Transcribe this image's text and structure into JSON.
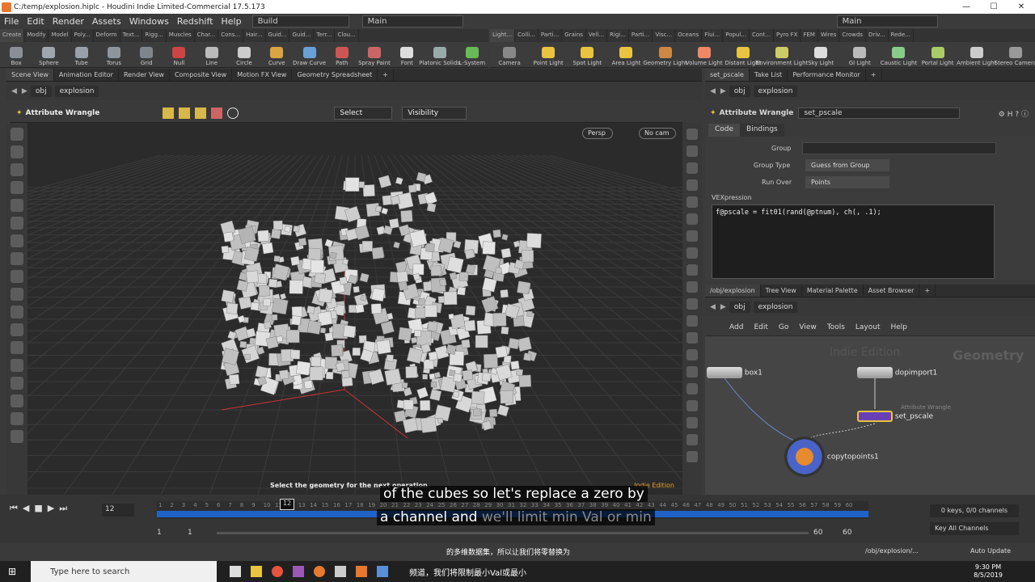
{
  "window": {
    "title": "C:/temp/explosion.hiplc - Houdini Indie Limited-Commercial 17.5.173",
    "min": "—",
    "max": "☐",
    "close": "✕"
  },
  "menu": {
    "items": [
      "File",
      "Edit",
      "Render",
      "Assets",
      "Windows",
      "Redshift",
      "Help"
    ],
    "desktop_label": "Build",
    "desktop2_label": "Main",
    "desktop3_label": "Main"
  },
  "shelf_left": {
    "tabs": [
      "Create",
      "Modify",
      "Model",
      "Poly...",
      "Deform",
      "Text...",
      "Rigg...",
      "Muscles",
      "Char...",
      "Cons...",
      "Hair...",
      "Guid...",
      "Guid...",
      "Terr...",
      "Clou..."
    ],
    "tools": [
      {
        "label": "Box",
        "color": "#8a8f96"
      },
      {
        "label": "Sphere",
        "color": "#a0a6ad"
      },
      {
        "label": "Tube",
        "color": "#9aa0a7"
      },
      {
        "label": "Torus",
        "color": "#8f959c"
      },
      {
        "label": "Grid",
        "color": "#7f858c"
      },
      {
        "label": "Null",
        "color": "#c44"
      },
      {
        "label": "Line",
        "color": "#bbb"
      },
      {
        "label": "Circle",
        "color": "#ccc"
      },
      {
        "label": "Curve",
        "color": "#d9a441"
      },
      {
        "label": "Draw Curve",
        "color": "#6aa0d8"
      },
      {
        "label": "Path",
        "color": "#c55"
      },
      {
        "label": "Spray Paint",
        "color": "#c66"
      },
      {
        "label": "Font",
        "color": "#ddd"
      },
      {
        "label": "Platonic Solids",
        "color": "#9aa"
      },
      {
        "label": "L-System",
        "color": "#6b5"
      }
    ]
  },
  "shelf_right": {
    "tabs": [
      "Light...",
      "Colli...",
      "Parti...",
      "Grains",
      "Vell...",
      "Rigi...",
      "Parti...",
      "Visc...",
      "Oceans",
      "Flui...",
      "Popul...",
      "Cont...",
      "Pyro FX",
      "FEM",
      "Wires",
      "Crowds",
      "Driv...",
      "Rede..."
    ],
    "tools": [
      {
        "label": "Camera",
        "color": "#888"
      },
      {
        "label": "Point Light",
        "color": "#e8c440"
      },
      {
        "label": "Spot Light",
        "color": "#e8c440"
      },
      {
        "label": "Area Light",
        "color": "#e8c440"
      },
      {
        "label": "Geometry Light",
        "color": "#c84"
      },
      {
        "label": "Volume Light",
        "color": "#e86"
      },
      {
        "label": "Distant Light",
        "color": "#e8c440"
      },
      {
        "label": "Environment Light",
        "color": "#cc6"
      },
      {
        "label": "Sky Light",
        "color": "#ddd"
      },
      {
        "label": "GI Light",
        "color": "#bbb"
      },
      {
        "label": "Caustic Light",
        "color": "#8c8"
      },
      {
        "label": "Portal Light",
        "color": "#ac6"
      },
      {
        "label": "Ambient Light",
        "color": "#ccc"
      },
      {
        "label": "Stereo Camera",
        "color": "#999"
      }
    ]
  },
  "left_pane": {
    "tabs": [
      "Scene View",
      "Animation Editor",
      "Render View",
      "Composite View",
      "Motion FX View",
      "Geometry Spreadsheet"
    ],
    "path_root": "obj",
    "path_node": "explosion",
    "toolbar_label": "Attribute Wrangle",
    "select_label": "Select",
    "visibility_label": "Visibility",
    "persp_label": "Persp",
    "cam_label": "No cam",
    "status_text": "Select the geometry for the next operation",
    "indie_text": "Indie Edition"
  },
  "param_pane": {
    "tabs": [
      "set_pscale",
      "Take List",
      "Performance Monitor"
    ],
    "path_root": "obj",
    "path_node": "explosion",
    "node_type": "Attribute Wrangle",
    "node_name": "set_pscale",
    "subtabs": [
      "Code",
      "Bindings"
    ],
    "group_label": "Group",
    "group_value": "",
    "group_type_label": "Group Type",
    "group_type_value": "Guess from Group",
    "run_over_label": "Run Over",
    "run_over_value": "Points",
    "vex_label": "VEXpression",
    "vex_code": "f@pscale = fit01(rand(@ptnum), ch(, .1);"
  },
  "network_pane": {
    "tabs": [
      "/obj/explosion",
      "Tree View",
      "Material Palette",
      "Asset Browser"
    ],
    "path_root": "obj",
    "path_node": "explosion",
    "menu": [
      "Add",
      "Edit",
      "Go",
      "View",
      "Tools",
      "Layout",
      "Help"
    ],
    "watermark_left": "Indie Edition",
    "watermark_right": "Geometry",
    "nodes": {
      "box": "box1",
      "dopimport": "dopimport1",
      "wrangle_type": "Attribute Wrangle",
      "wrangle": "set_pscale",
      "copy": "copytopoints1"
    }
  },
  "timeline": {
    "current_frame": "12",
    "frame_field": "12",
    "ticks": [
      "1",
      "2",
      "3",
      "4",
      "5",
      "6",
      "7",
      "8",
      "9",
      "10",
      "11",
      "12",
      "13",
      "14",
      "15",
      "16",
      "17",
      "18",
      "19",
      "20",
      "21",
      "22",
      "23",
      "24",
      "25",
      "26",
      "27",
      "28",
      "29",
      "30",
      "31",
      "32",
      "33",
      "34",
      "35",
      "36",
      "37",
      "38",
      "39",
      "40",
      "41",
      "42",
      "43",
      "44",
      "45",
      "46",
      "47",
      "48",
      "49",
      "50",
      "51",
      "52",
      "53",
      "54",
      "55",
      "56",
      "57",
      "58",
      "59",
      "60"
    ],
    "range_start": "1",
    "range_start2": "1",
    "range_end": "60",
    "range_end2": "60",
    "keys_label": "0 keys, 0/0 channels",
    "key_all_label": "Key All Channels",
    "auto_update": "Auto Update",
    "status_path": "/obj/explosion/..."
  },
  "subtitles": {
    "line1": "of the cubes so let's replace a zero by",
    "line2a": "a channel and",
    "line2b": " we'll limit min Val or min",
    "cn1": "的多维数据集，所以让我们将零替换为",
    "cn2": "频道，我们将限制最小Val或最小"
  },
  "taskbar": {
    "search_placeholder": "Type here to search",
    "time": "9:30 PM",
    "date": "8/5/2019"
  }
}
